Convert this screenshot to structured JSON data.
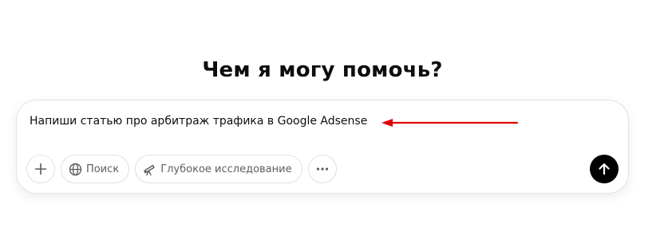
{
  "heading": "Чем я могу помочь?",
  "composer": {
    "input_value": "Напиши статью про арбитраж трафика в Google Adsense"
  },
  "toolbar": {
    "add_icon": "plus-icon",
    "search_label": "Поиск",
    "search_icon": "globe-icon",
    "deep_research_label": "Глубокое исследование",
    "deep_research_icon": "telescope-icon",
    "more_icon": "ellipsis-icon",
    "send_icon": "arrow-up-icon"
  },
  "annotation": {
    "arrow_color": "#e00000"
  },
  "colors": {
    "send_button_bg": "#000000",
    "border": "#e3e3e3",
    "muted_text": "#5d5d5d"
  }
}
